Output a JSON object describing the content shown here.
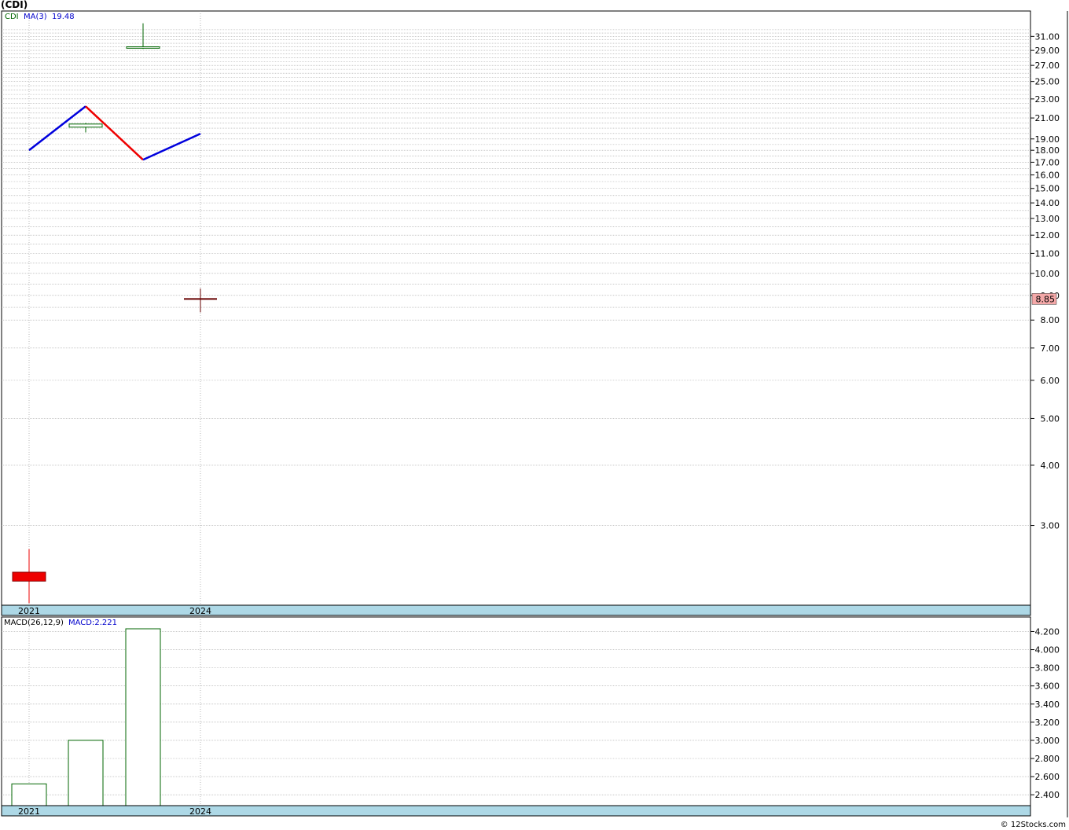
{
  "title": "(CDI)",
  "credit": "© 12Stocks.com",
  "chart_data": [
    {
      "type": "candlestick",
      "legend": {
        "symbol": "CDI",
        "ma_label": "MA(3)",
        "ma_value": "19.48"
      },
      "scale": "log",
      "ylim": [
        2.05,
        35
      ],
      "y_ticks": [
        "31.00",
        "29.00",
        "27.00",
        "25.00",
        "23.00",
        "21.00",
        "19.00",
        "18.00",
        "17.00",
        "16.00",
        "15.00",
        "14.00",
        "13.00",
        "12.00",
        "11.00",
        "10.00",
        "9.00",
        "8.00",
        "7.00",
        "6.00",
        "5.00",
        "4.00",
        "3.00"
      ],
      "x_labels": [
        "2021",
        "2024"
      ],
      "last_price": "8.85",
      "candles": [
        {
          "period": "2021",
          "open": 2.4,
          "close": 2.3,
          "high": 2.68,
          "low": 2.07,
          "color": "#ee0000",
          "filled": true
        },
        {
          "period": "2022",
          "open": 20.1,
          "close": 20.4,
          "high": 20.5,
          "low": 19.6,
          "color": "#006600",
          "filled": false
        },
        {
          "period": "2023",
          "open": 29.3,
          "close": 29.5,
          "high": 33.0,
          "low": 29.2,
          "color": "#006600",
          "filled": false
        },
        {
          "period": "2024",
          "open": 8.85,
          "close": 8.85,
          "high": 9.3,
          "low": 8.3,
          "color": "#660000",
          "filled": false
        }
      ],
      "ma_series": [
        {
          "period": "2021",
          "value": 18.0
        },
        {
          "period": "2022",
          "value": 22.2
        },
        {
          "period": "2023",
          "value": 17.2
        },
        {
          "period": "2024",
          "value": 19.48
        }
      ],
      "ma_colors": {
        "up": "#0000dd",
        "down": "#ee0000"
      }
    },
    {
      "type": "bar",
      "legend": {
        "name": "MACD(26,12,9)",
        "value_label": "MACD:2.221"
      },
      "ylim": [
        2.28,
        4.36
      ],
      "y_ticks": [
        "4.200",
        "4.000",
        "3.800",
        "3.600",
        "3.400",
        "3.200",
        "3.000",
        "2.800",
        "2.600",
        "2.400"
      ],
      "x_labels": [
        "2021",
        "2024"
      ],
      "bars": [
        {
          "period": "2021",
          "value": 2.52
        },
        {
          "period": "2022",
          "value": 3.0
        },
        {
          "period": "2023",
          "value": 4.23
        }
      ]
    }
  ]
}
